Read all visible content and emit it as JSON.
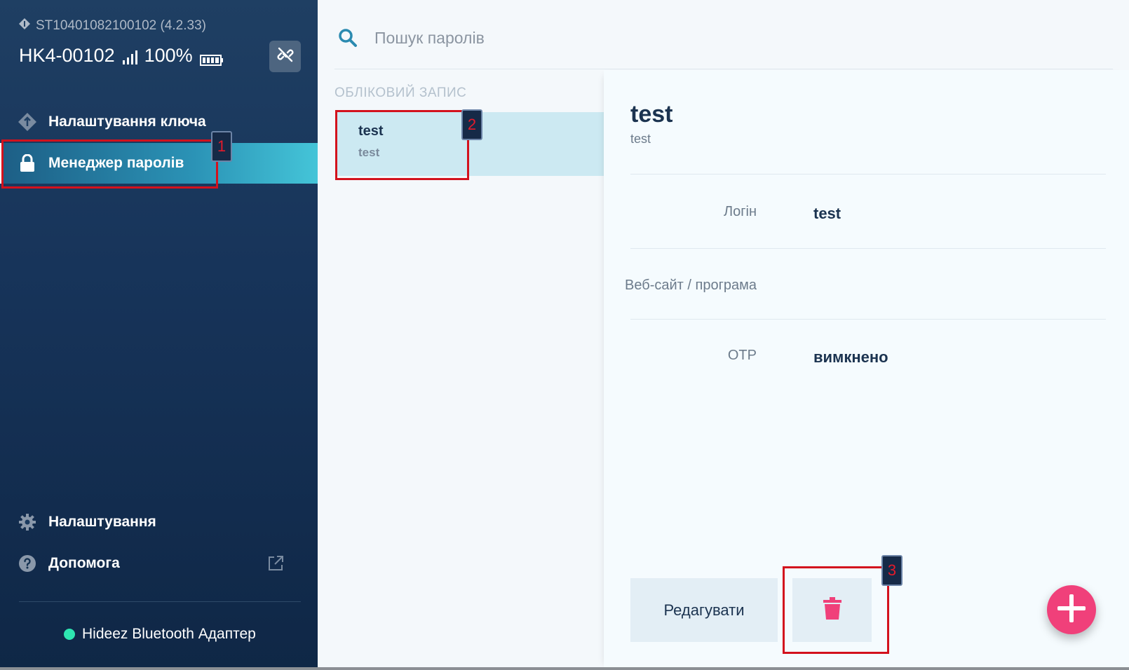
{
  "device": {
    "serial": "ST10401082100102 (4.2.33)",
    "name": "HK4-00102",
    "battery_percent": "100%"
  },
  "sidebar": {
    "items": [
      {
        "label": "Налаштування ключа",
        "icon": "key-diamond-icon"
      },
      {
        "label": "Менеджер паролів",
        "icon": "lock-icon",
        "active": true
      },
      {
        "label": "Налаштування",
        "icon": "gear-icon"
      },
      {
        "label": "Допомога",
        "icon": "help-icon"
      }
    ],
    "adapter_label": "Hideez Bluetooth Адаптер",
    "adapter_status_color": "#2ee6b1"
  },
  "search": {
    "placeholder": "Пошук паролів"
  },
  "list": {
    "header": "ОБЛІКОВИЙ ЗАПИС",
    "items": [
      {
        "title": "test",
        "subtitle": "test",
        "selected": true
      }
    ]
  },
  "detail": {
    "title": "test",
    "subtitle": "test",
    "fields": [
      {
        "label": "Логін",
        "value": "test"
      },
      {
        "label": "Веб-сайт / програма",
        "value": ""
      },
      {
        "label": "OTP",
        "value": "вимкнено"
      }
    ],
    "edit_label": "Редагувати"
  },
  "markers": [
    "1",
    "2",
    "3"
  ],
  "colors": {
    "accent": "#45c6d9",
    "danger": "#f0407a",
    "sidebar_bg": "#17345a"
  }
}
